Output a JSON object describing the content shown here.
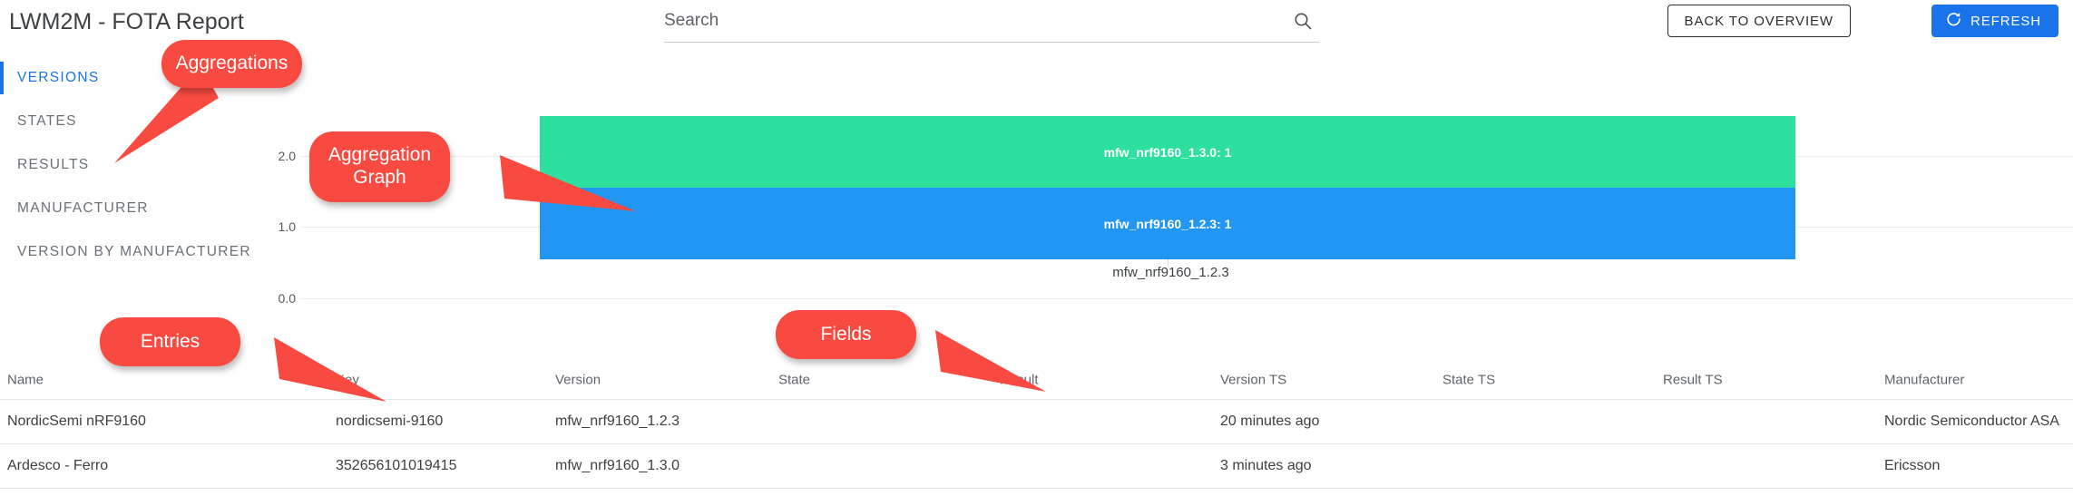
{
  "header": {
    "title": "LWM2M - FOTA Report",
    "search": {
      "value": "",
      "placeholder": "Search",
      "icon": "search-icon"
    },
    "back_button": "BACK TO OVERVIEW",
    "refresh_button": "REFRESH",
    "refresh_icon": "refresh-icon"
  },
  "sidebar": {
    "items": [
      {
        "label": "VERSIONS",
        "active": true
      },
      {
        "label": "STATES",
        "active": false
      },
      {
        "label": "RESULTS",
        "active": false
      },
      {
        "label": "MANUFACTURER",
        "active": false
      },
      {
        "label": "VERSION BY MANUFACTURER",
        "active": false
      }
    ]
  },
  "chart_data": {
    "type": "bar",
    "stacked": true,
    "title": "",
    "xlabel": "",
    "ylabel": "",
    "categories": [
      "mfw_nrf9160_1.2.3"
    ],
    "ytick_labels": [
      "2.0",
      "1.0",
      "0.0"
    ],
    "ylim": [
      0,
      2
    ],
    "grid": true,
    "legend": "none",
    "series": [
      {
        "name": "mfw_nrf9160_1.3.0",
        "values": [
          1
        ],
        "color": "#2ee0a0",
        "data_label": "mfw_nrf9160_1.3.0: 1"
      },
      {
        "name": "mfw_nrf9160_1.2.3",
        "values": [
          1
        ],
        "color": "#2196f3",
        "data_label": "mfw_nrf9160_1.2.3: 1"
      }
    ]
  },
  "table": {
    "columns": [
      "Name",
      "Key",
      "Version",
      "State",
      "Result",
      "Version TS",
      "State TS",
      "Result TS",
      "Manufacturer"
    ],
    "rows": [
      {
        "name": "NordicSemi nRF9160",
        "key": "nordicsemi-9160",
        "version": "mfw_nrf9160_1.2.3",
        "state": "",
        "result": "",
        "version_ts": "20 minutes ago",
        "state_ts": "",
        "result_ts": "",
        "manufacturer": "Nordic Semiconductor ASA"
      },
      {
        "name": "Ardesco - Ferro",
        "key": "352656101019415",
        "version": "mfw_nrf9160_1.3.0",
        "state": "",
        "result": "",
        "version_ts": "3 minutes ago",
        "state_ts": "",
        "result_ts": "",
        "manufacturer": "Ericsson"
      }
    ]
  },
  "annotations": {
    "color": "#f84a40",
    "items": [
      {
        "label": "Aggregations"
      },
      {
        "label": "Aggregation\nGraph"
      },
      {
        "label": "Entries"
      },
      {
        "label": "Fields"
      }
    ]
  }
}
